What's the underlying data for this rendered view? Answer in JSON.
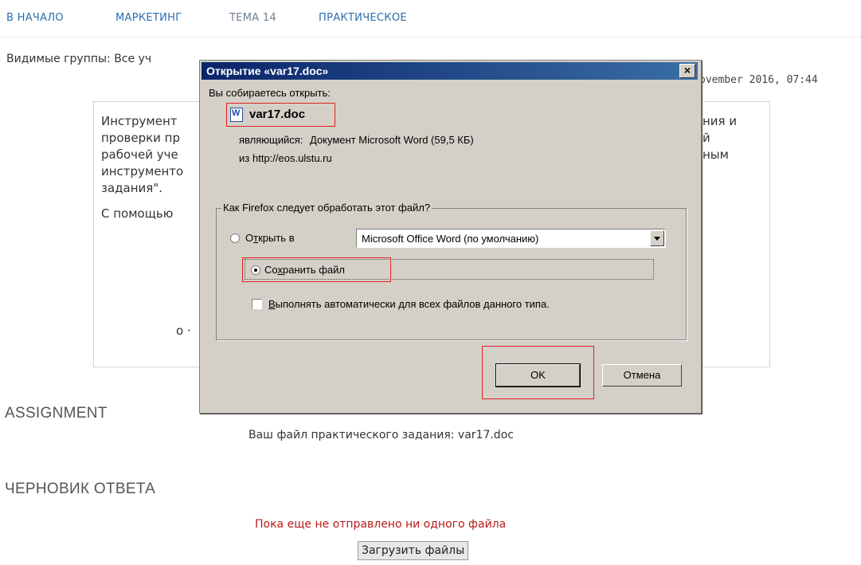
{
  "breadcrumb": {
    "items": [
      {
        "label": "В НАЧАЛО"
      },
      {
        "label": "МАРКЕТИНГ"
      },
      {
        "label": "ТЕМА 14"
      },
      {
        "label": "ПРАКТИЧЕСКОЕ"
      }
    ]
  },
  "page": {
    "groups_text": "Видимые группы: Все уч",
    "date_text": "ovember 2016, 07:44",
    "intro": {
      "left_lines": [
        "Инструмент",
        "проверки пр",
        "рабочей уче",
        "инструменто",
        "задания\".",
        "С помощью"
      ],
      "right_lines": [
        "ния и",
        "й",
        "ным"
      ],
      "bullet": "o ·"
    },
    "assignment_heading": "ASSIGNMENT",
    "assignment_file": "Ваш файл практического задания: var17.doc",
    "draft_heading": "ЧЕРНОВИК ОТВЕТА",
    "no_files": "Пока еще не отправлено ни одного файла",
    "upload_button": "Загрузить файлы"
  },
  "dialog": {
    "title": "Открытие «var17.doc»",
    "close_glyph": "×",
    "about_to_open": "Вы собираетесь открыть:",
    "file_name": "var17.doc",
    "file_type_label": "являющийся:",
    "file_type_value": "Документ Microsoft Word (59,5 КБ)",
    "from_label": "из",
    "from_value": "http://eos.ulstu.ru",
    "group_label": "Как Firefox следует обработать этот файл?",
    "open_with_prefix": "О",
    "open_with_accel": "т",
    "open_with_suffix": "крыть в",
    "open_with_app": "Microsoft Office Word (по умолчанию)",
    "save_prefix": "Со",
    "save_accel": "х",
    "save_suffix": "ранить файл",
    "auto_accel": "В",
    "auto_suffix": "ыполнять автоматически для всех файлов данного типа.",
    "selected_option": "save",
    "auto_checked": false,
    "ok_button": "OK",
    "cancel_button": "Отмена"
  },
  "colors": {
    "link": "#2a6db0",
    "highlight": "#e02020",
    "error_text": "#b81a1a",
    "dialog_face": "#d4d0c8",
    "titlebar_start": "#0a246a",
    "titlebar_end": "#3a6ea5"
  }
}
